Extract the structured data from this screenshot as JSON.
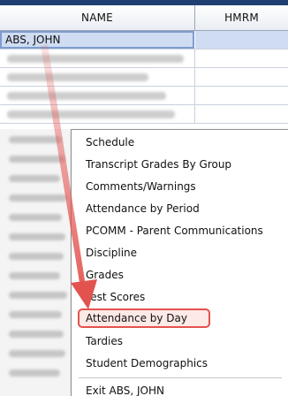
{
  "grid": {
    "columns": [
      "NAME",
      "HMRM"
    ],
    "rows": [
      {
        "name": "ABS, JOHN",
        "hmrm": ""
      }
    ]
  },
  "context_menu": {
    "items": [
      {
        "label": "Schedule"
      },
      {
        "label": "Transcript Grades By Group"
      },
      {
        "label": "Comments/Warnings"
      },
      {
        "label": "Attendance by Period"
      },
      {
        "label": "PCOMM - Parent Communications"
      },
      {
        "label": "Discipline"
      },
      {
        "label": "Grades"
      },
      {
        "label": "Test Scores"
      },
      {
        "label": "Attendance by Day"
      },
      {
        "label": "Tardies"
      },
      {
        "label": "Student Demographics"
      },
      {
        "label": "Exit ABS, JOHN"
      }
    ]
  },
  "colors": {
    "highlight_border": "#e2534f",
    "arrow": "#e2534f",
    "selected_row": "#cfdcf2"
  }
}
